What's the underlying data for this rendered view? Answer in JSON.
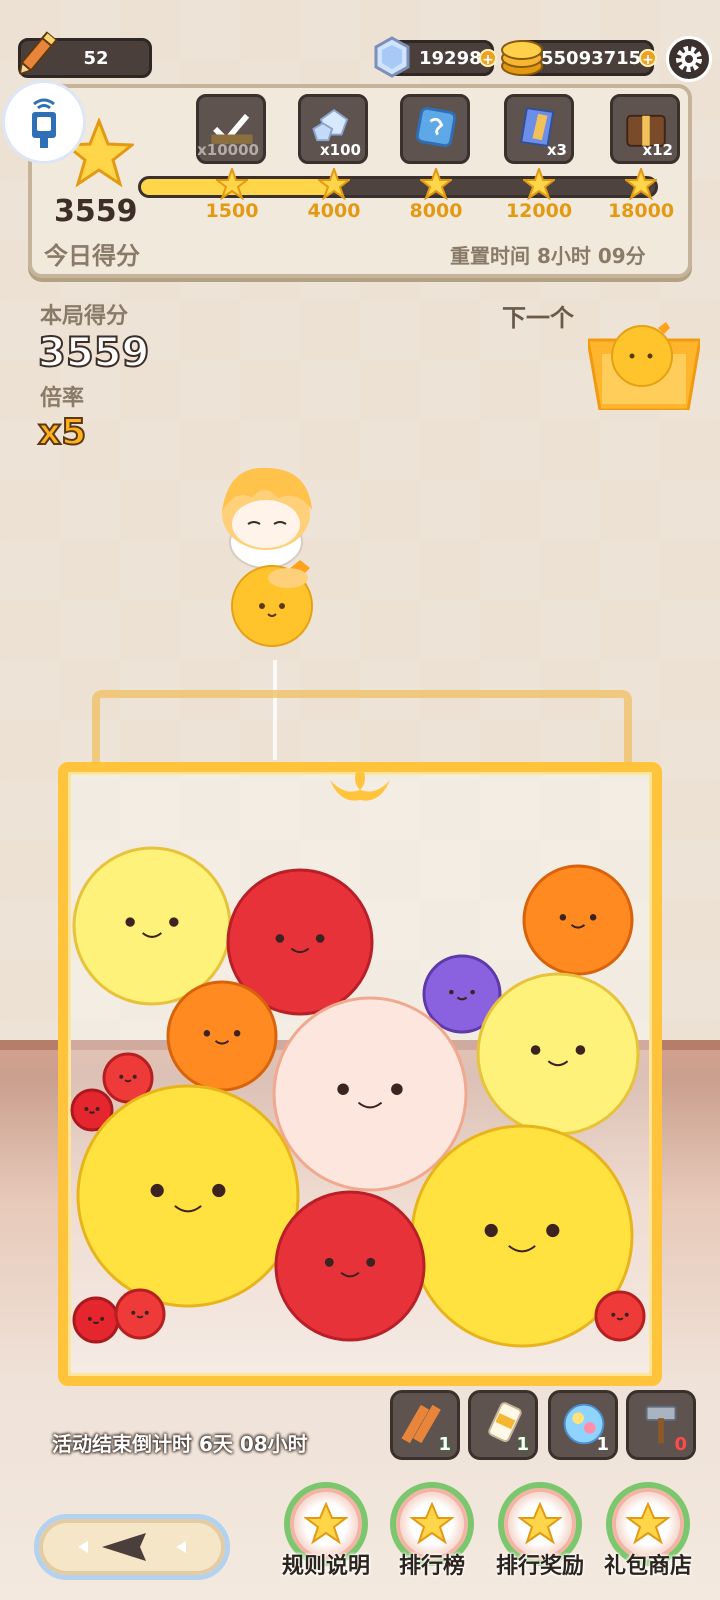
{
  "top": {
    "level": "52",
    "gems": "19298",
    "coins": "55093715"
  },
  "daily": {
    "score": "3559",
    "label": "今日得分",
    "reset_text": "重置时间 8小时 09分",
    "progress": 0.37,
    "rewards": [
      {
        "icon": "check-icon",
        "qty": "x10000",
        "claimed": true
      },
      {
        "icon": "diamond-pile-icon",
        "qty": "x100",
        "claimed": false
      },
      {
        "icon": "blue-rune-icon",
        "qty": "",
        "claimed": false
      },
      {
        "icon": "blue-cape-icon",
        "qty": "x3",
        "claimed": false
      },
      {
        "icon": "chest-icon",
        "qty": "x12",
        "claimed": false
      }
    ],
    "milestones": [
      "1500",
      "4000",
      "8000",
      "12000",
      "18000"
    ]
  },
  "round": {
    "score_label": "本局得分",
    "score": "3559",
    "mult_label": "倍率",
    "multiplier": "x5",
    "next_label": "下一个"
  },
  "countdown": "活动结束倒计时 6天 08小时",
  "tools": [
    {
      "name": "pencils-tool",
      "count": "1",
      "style": "green"
    },
    {
      "name": "bottle-tool",
      "count": "1",
      "style": "green"
    },
    {
      "name": "orb-tool",
      "count": "1",
      "style": "plain"
    },
    {
      "name": "hammer-tool",
      "count": "0",
      "style": "zero"
    }
  ],
  "menu": [
    "规则说明",
    "排行榜",
    "排行奖励",
    "礼包商店"
  ],
  "colors": {
    "accent": "#ffc43b",
    "milestone": "#e39a12",
    "dark_panel": "#5e534e"
  }
}
